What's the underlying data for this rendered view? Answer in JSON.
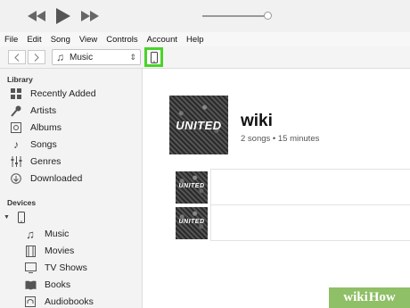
{
  "menu": [
    "File",
    "Edit",
    "Song",
    "View",
    "Controls",
    "Account",
    "Help"
  ],
  "playback": {
    "progress": 0.95
  },
  "toolbar": {
    "media_label": "Music"
  },
  "sidebar": {
    "library_title": "Library",
    "library_items": [
      {
        "label": "Recently Added",
        "icon": "grid-icon"
      },
      {
        "label": "Artists",
        "icon": "microphone-icon"
      },
      {
        "label": "Albums",
        "icon": "album-icon"
      },
      {
        "label": "Songs",
        "icon": "music-note-icon"
      },
      {
        "label": "Genres",
        "icon": "genres-icon"
      },
      {
        "label": "Downloaded",
        "icon": "download-icon"
      }
    ],
    "devices_title": "Devices",
    "device_items": [
      {
        "label": "Music",
        "icon": "music-note-icon"
      },
      {
        "label": "Movies",
        "icon": "film-icon"
      },
      {
        "label": "TV Shows",
        "icon": "tv-icon"
      },
      {
        "label": "Books",
        "icon": "book-icon"
      },
      {
        "label": "Audiobooks",
        "icon": "audiobook-icon"
      }
    ]
  },
  "album": {
    "title": "wiki",
    "meta": "2 songs • 15 minutes",
    "art_text": "UNITED"
  },
  "tracks": [
    {
      "art_text": "UNITED"
    },
    {
      "art_text": "UNITED"
    }
  ],
  "watermark": {
    "part1": "wiki",
    "part2": "How"
  },
  "colors": {
    "highlight": "#4ad32a",
    "watermark_bg": "#8fbf66"
  }
}
